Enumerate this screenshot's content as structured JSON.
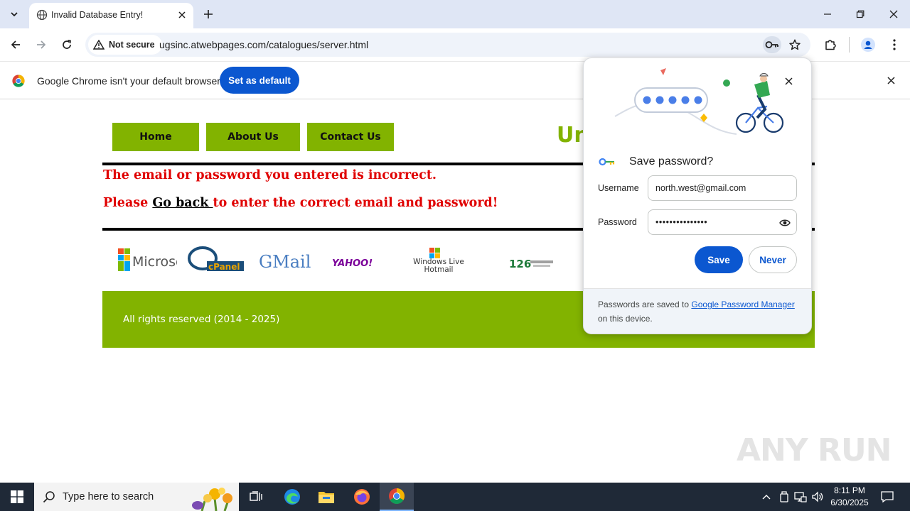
{
  "browser": {
    "tab_title": "Invalid Database Entry!",
    "security_label": "Not secure",
    "url": "ugsinc.atwebpages.com/catalogues/server.html"
  },
  "infobar": {
    "message": "Google Chrome isn't your default browser",
    "button_label": "Set as default"
  },
  "site": {
    "nav": [
      "Home",
      "About Us",
      "Contact Us"
    ],
    "brand_partial": "Uni",
    "error_line1": "The email or password you entered is incorrect.",
    "error_line2_prefix": "Please ",
    "error_line2_link": "Go back ",
    "error_line2_suffix": "to enter the correct email and password!",
    "logos": [
      "Microsoft",
      "cPanel",
      "GMail",
      "YAHOO!",
      "Windows Live Hotmail",
      "126"
    ],
    "footer": "All rights reserved (2014 - 2025)",
    "accent_color": "#82b300",
    "error_color": "#e00000"
  },
  "popup": {
    "title": "Save password?",
    "username_label": "Username",
    "username_value": "north.west@gmail.com",
    "password_label": "Password",
    "password_value": "•••••••••••••••",
    "save_label": "Save",
    "never_label": "Never",
    "footer_prefix": "Passwords are saved to ",
    "footer_link": "Google Password Manager",
    "footer_suffix": " on this device."
  },
  "taskbar": {
    "search_placeholder": "Type here to search",
    "time": "8:11 PM",
    "date": "6/30/2025"
  },
  "watermark": "ANY RUN"
}
